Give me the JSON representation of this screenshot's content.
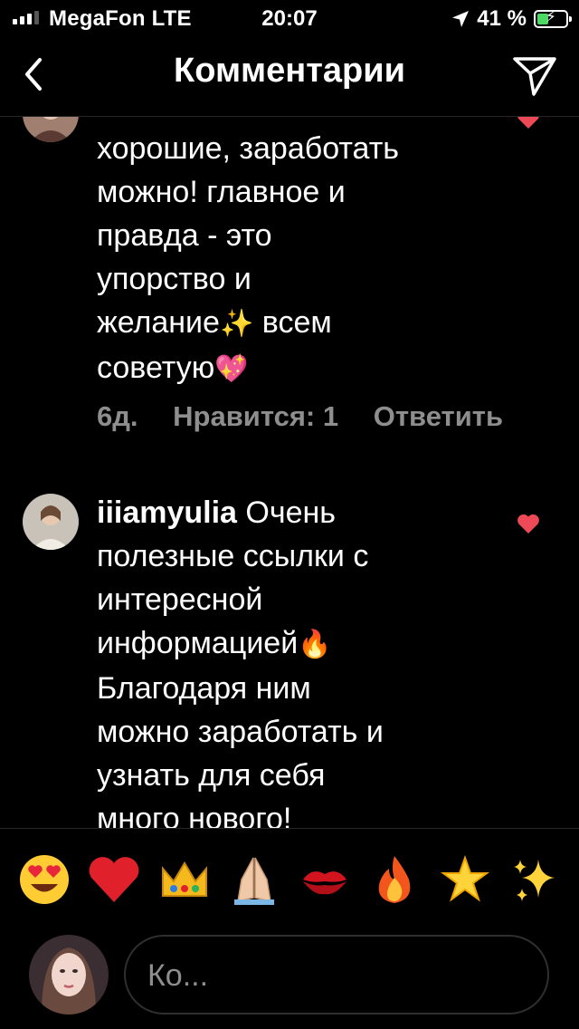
{
  "status_bar": {
    "carrier": "MegaFon LTE",
    "time": "20:07",
    "battery_percent": "41 %",
    "battery_level": 0.41,
    "signal_bars": 3
  },
  "header": {
    "title": "Комментарии",
    "back_icon": "chevron-left-icon",
    "send_icon": "paper-plane-icon"
  },
  "comments": [
    {
      "lines": [
        "хорошие, заработать",
        "можно! главное и",
        "правда - это",
        "упорство и"
      ],
      "line5_before": "желание",
      "line5_emoji": "✨",
      "line5_after": " всем",
      "line6_before": "советую",
      "line6_emoji": "💖",
      "time": "6д.",
      "likes": "Нравится: 1",
      "reply": "Ответить",
      "liked": true
    },
    {
      "username": "iiiamyulia",
      "line1_after": " Очень",
      "lines": [
        "полезные ссылки с",
        "интересной"
      ],
      "line4_before": "информацией",
      "line4_emoji": "🔥",
      "lines_after": [
        "Благодаря ним",
        "можно заработать и",
        "узнать для себя",
        "много нового!"
      ],
      "liked": true
    }
  ],
  "emoji_bar": [
    "😍",
    "❤️",
    "👑",
    "🙏",
    "💋",
    "🔥",
    "🌟",
    "✨"
  ],
  "input": {
    "placeholder": "Ко..."
  },
  "colors": {
    "background": "#000000",
    "muted_text": "#8e8e8e",
    "like_red": "#ed4956",
    "battery_green": "#4cd964",
    "divider": "#262626"
  }
}
